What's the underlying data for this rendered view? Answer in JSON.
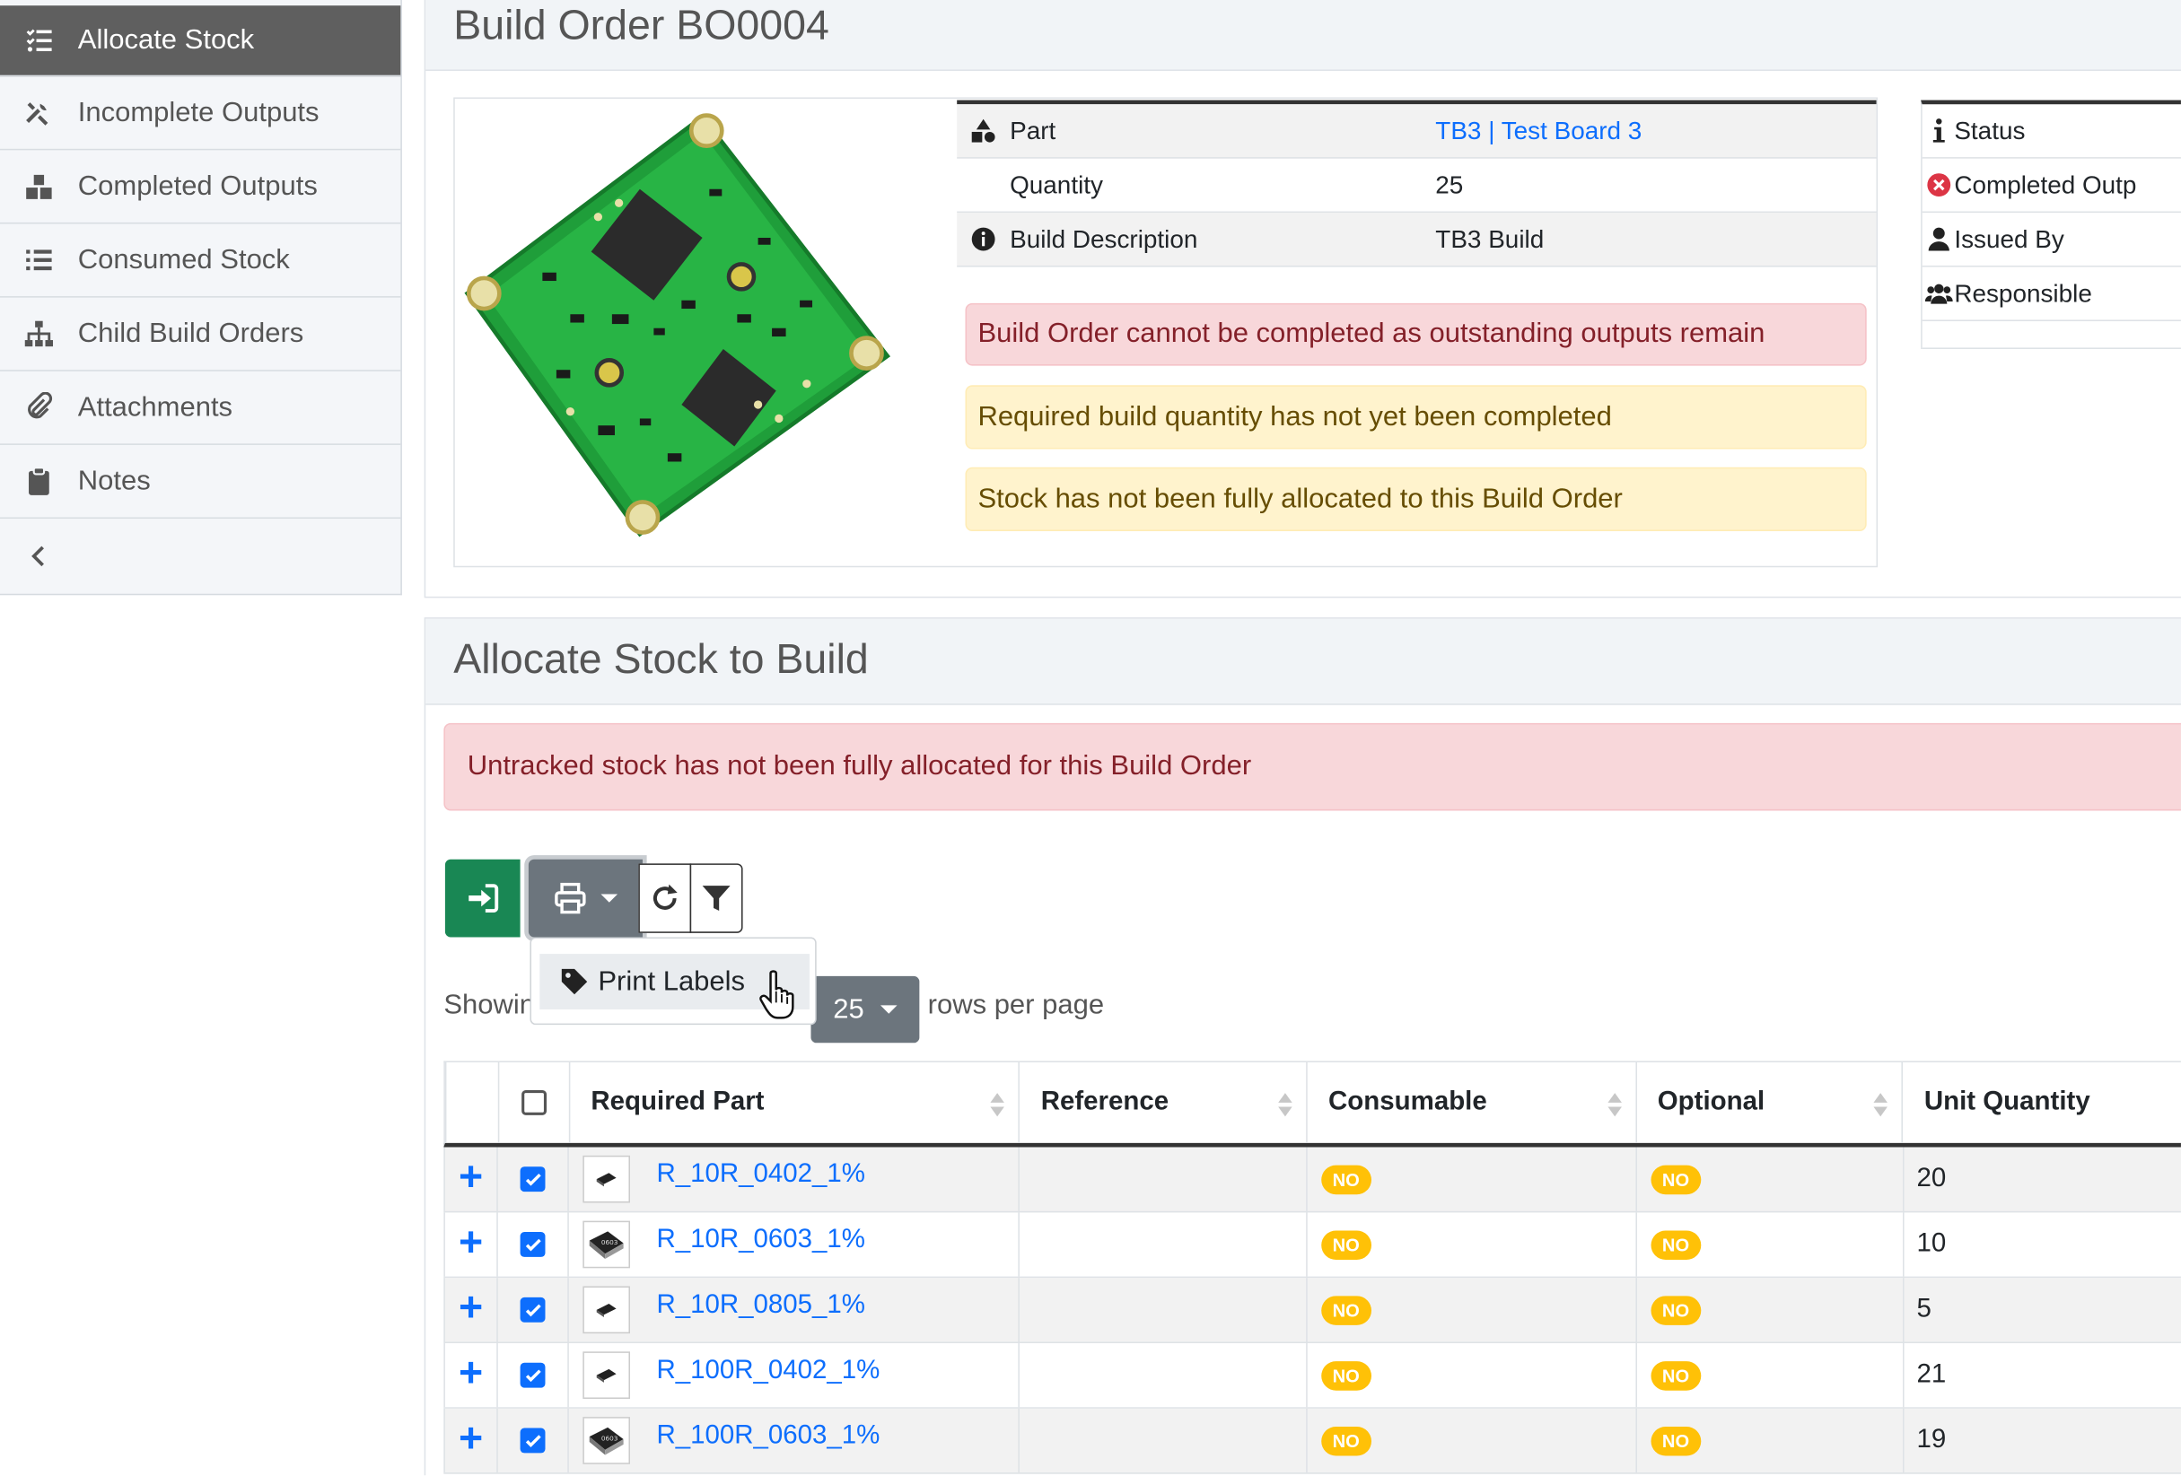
{
  "sidebar": {
    "items": [
      {
        "label": "Allocate Stock",
        "icon": "tasks-icon"
      },
      {
        "label": "Incomplete Outputs",
        "icon": "tools-icon"
      },
      {
        "label": "Completed Outputs",
        "icon": "boxes-icon"
      },
      {
        "label": "Consumed Stock",
        "icon": "list-icon"
      },
      {
        "label": "Child Build Orders",
        "icon": "sitemap-icon"
      },
      {
        "label": "Attachments",
        "icon": "paperclip-icon"
      },
      {
        "label": "Notes",
        "icon": "clipboard-icon"
      }
    ],
    "collapse_icon": "chevron-left-icon"
  },
  "build": {
    "title": "Build Order BO0004",
    "details": [
      {
        "key": "Part",
        "value": "TB3 | Test Board 3",
        "icon": "shapes-icon"
      },
      {
        "key": "Quantity",
        "value": "25"
      },
      {
        "key": "Build Description",
        "value": "TB3 Build",
        "icon": "info-circle-icon"
      }
    ],
    "alerts": [
      "Build Order cannot be completed as outstanding outputs remain",
      "Required build quantity has not yet been completed",
      "Stock has not been fully allocated to this Build Order"
    ],
    "status_rows": [
      {
        "key": "Status",
        "icon": "info-icon"
      },
      {
        "key": "Completed Outp",
        "icon": "times-circle-icon"
      },
      {
        "key": "Issued By",
        "icon": "user-icon"
      },
      {
        "key": "Responsible",
        "icon": "users-icon"
      }
    ]
  },
  "allocate": {
    "title": "Allocate Stock to Build",
    "alert": "Untracked stock has not been fully allocated for this Build Order",
    "dropdown_item": "Print Labels",
    "showing": "Showin",
    "page_size": "25",
    "rows_per_page": "rows per page",
    "columns": [
      "Required Part",
      "Reference",
      "Consumable",
      "Optional",
      "Unit Quantity"
    ],
    "rows": [
      {
        "part": "R_10R_0402_1%",
        "reference": "",
        "consumable": "NO",
        "optional": "NO",
        "unit_quantity": "20"
      },
      {
        "part": "R_10R_0603_1%",
        "reference": "",
        "consumable": "NO",
        "optional": "NO",
        "unit_quantity": "10"
      },
      {
        "part": "R_10R_0805_1%",
        "reference": "",
        "consumable": "NO",
        "optional": "NO",
        "unit_quantity": "5"
      },
      {
        "part": "R_100R_0402_1%",
        "reference": "",
        "consumable": "NO",
        "optional": "NO",
        "unit_quantity": "21"
      },
      {
        "part": "R_100R_0603_1%",
        "reference": "",
        "consumable": "NO",
        "optional": "NO",
        "unit_quantity": "19"
      }
    ]
  },
  "colors": {
    "primary": "#0d6efd",
    "success": "#198754",
    "secondary": "#6c757d",
    "warning_badge": "#ffc107"
  }
}
